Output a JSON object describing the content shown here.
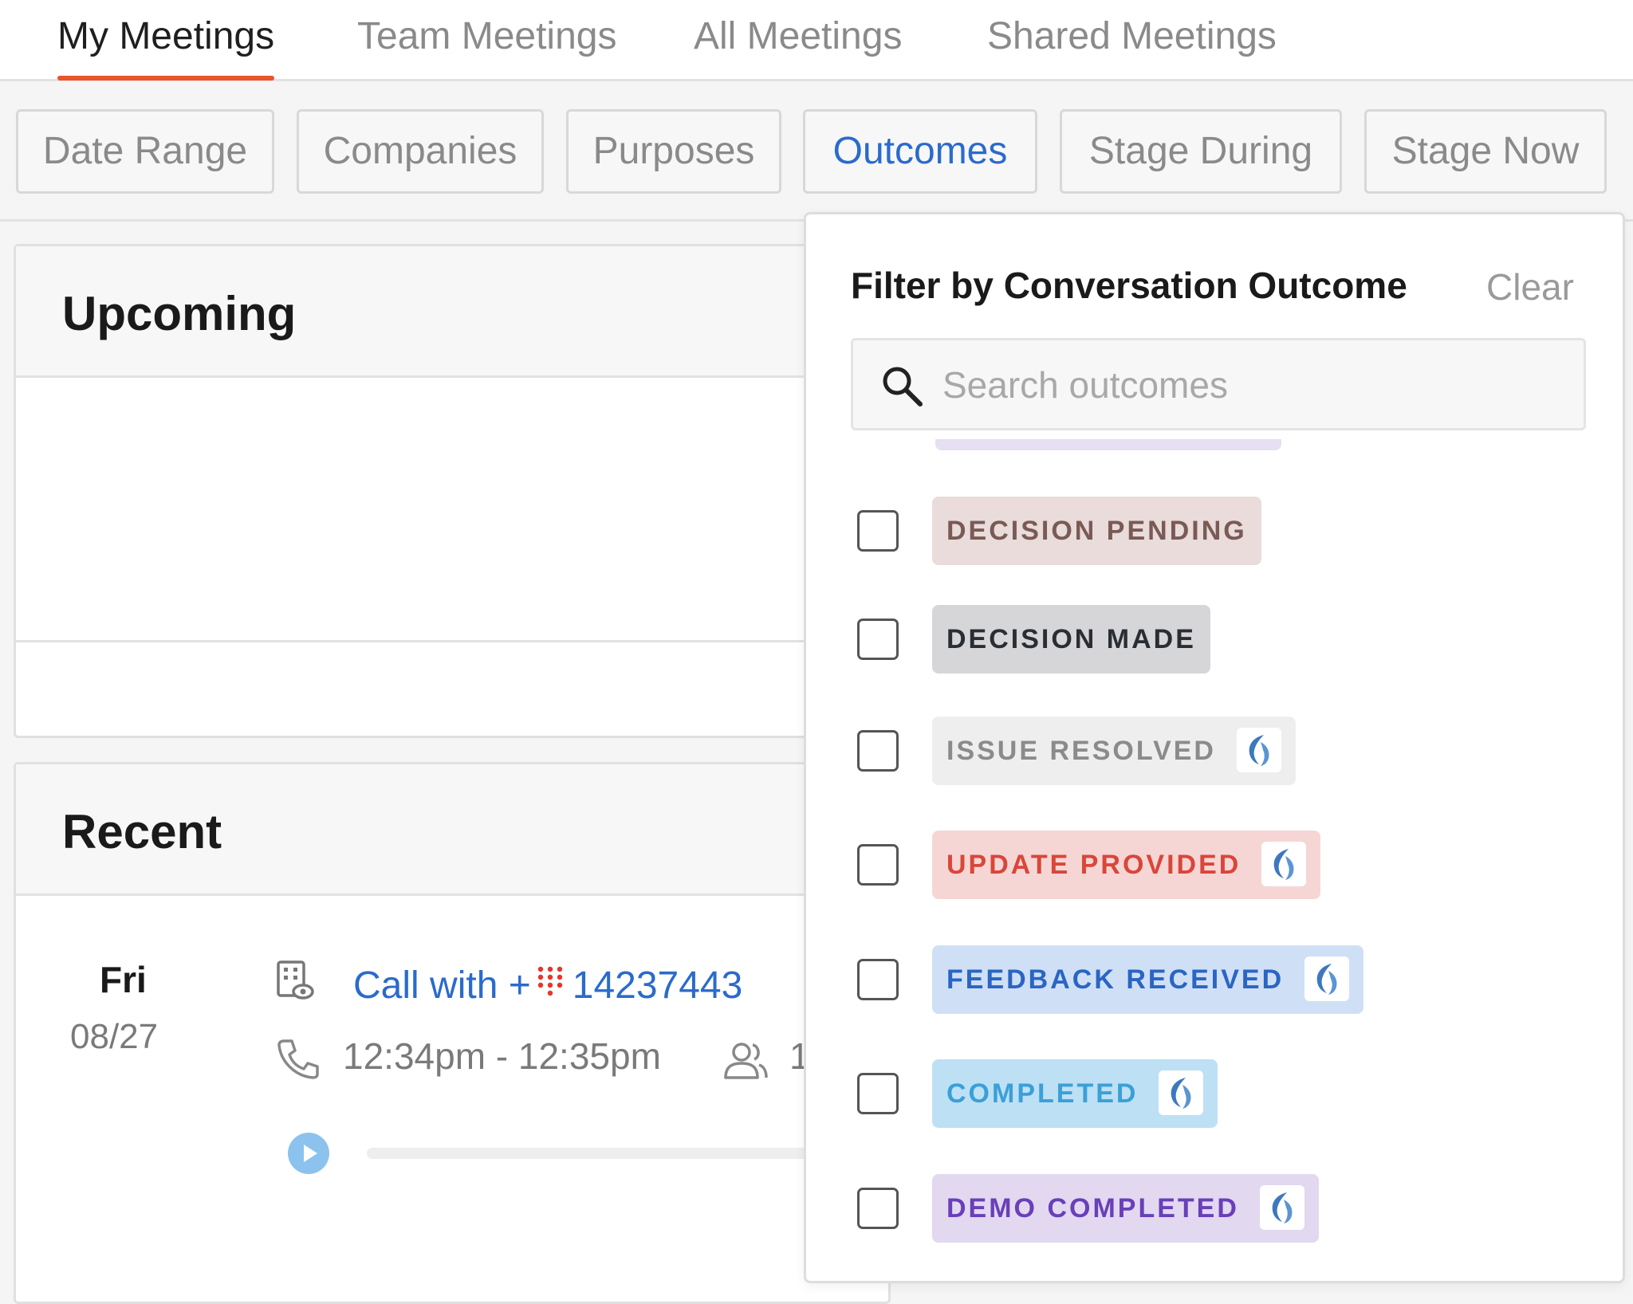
{
  "tabs": [
    {
      "label": "My Meetings",
      "active": true
    },
    {
      "label": "Team Meetings",
      "active": false
    },
    {
      "label": "All Meetings",
      "active": false
    },
    {
      "label": "Shared Meetings",
      "active": false
    }
  ],
  "filters": [
    {
      "label": "Date Range"
    },
    {
      "label": "Companies"
    },
    {
      "label": "Purposes"
    },
    {
      "label": "Outcomes",
      "active": true
    },
    {
      "label": "Stage During"
    },
    {
      "label": "Stage Now"
    }
  ],
  "upcoming": {
    "title": "Upcoming"
  },
  "recent": {
    "title": "Recent",
    "meeting": {
      "day": "Fri",
      "date": "08/27",
      "title_prefix": "Call with +",
      "title_number": "14237443",
      "time": "12:34pm - 12:35pm",
      "participants": "1"
    }
  },
  "outcome_filter": {
    "title": "Filter by Conversation Outcome",
    "clear_label": "Clear",
    "search_placeholder": "Search outcomes",
    "options": [
      {
        "label": "DECISION PENDING",
        "bg": "#e9dcdb",
        "fg": "#7a5a55",
        "logo": false
      },
      {
        "label": "DECISION MADE",
        "bg": "#d6d6d8",
        "fg": "#2a2e33",
        "logo": false
      },
      {
        "label": "ISSUE RESOLVED",
        "bg": "#eeeeee",
        "fg": "#8b8b8b",
        "logo": true
      },
      {
        "label": "UPDATE PROVIDED",
        "bg": "#f6d6d4",
        "fg": "#d9463a",
        "logo": true
      },
      {
        "label": "FEEDBACK RECEIVED",
        "bg": "#cfe0f6",
        "fg": "#2a65c4",
        "logo": true
      },
      {
        "label": "COMPLETED",
        "bg": "#bde0f4",
        "fg": "#3aa0d8",
        "logo": true
      },
      {
        "label": "DEMO COMPLETED",
        "bg": "#e2d8f0",
        "fg": "#6a3fb8",
        "logo": true
      }
    ]
  },
  "icons": {
    "building": "building-eye-icon",
    "phone": "phone-icon",
    "people": "people-icon",
    "play": "play-icon",
    "search": "search-icon",
    "logo": "outreach-logo-icon"
  },
  "colors": {
    "accent": "#e8542d",
    "link": "#2a6bcc"
  }
}
